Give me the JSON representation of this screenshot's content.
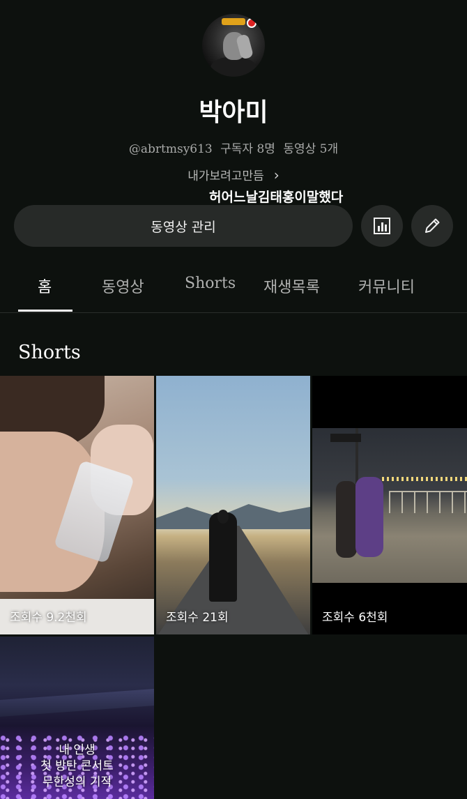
{
  "profile": {
    "name": "박아미",
    "handle": "@abrtmsy613",
    "subscribers": "구독자 8명",
    "videos": "동영상 5개",
    "description": "내가보려고만듬",
    "overlay_text": "허어느날김태홍이말했다"
  },
  "actions": {
    "manage_label": "동영상 관리",
    "stats_icon": "bar-chart-icon",
    "edit_icon": "pencil-icon"
  },
  "tabs": [
    {
      "label": "홈",
      "active": true
    },
    {
      "label": "동영상",
      "active": false
    },
    {
      "label": "Shorts",
      "active": false
    },
    {
      "label": "재생목록",
      "active": false
    },
    {
      "label": "커뮤니티",
      "active": false
    }
  ],
  "shorts_section": {
    "title": "Shorts",
    "items": [
      {
        "views": "조회수 9.2천회"
      },
      {
        "views": "조회수 21회"
      },
      {
        "views": "조회수 6천회"
      },
      {
        "views": "",
        "caption": [
          "내 인생",
          "첫 방탄 콘서트",
          "무한성의 기적"
        ]
      }
    ]
  }
}
